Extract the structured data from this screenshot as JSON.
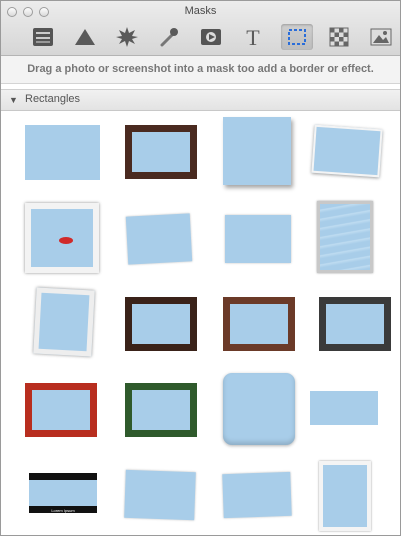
{
  "window": {
    "title": "Masks"
  },
  "toolbar": {
    "tools": [
      {
        "icon": "layers-icon"
      },
      {
        "icon": "triangle-icon"
      },
      {
        "icon": "starburst-icon"
      },
      {
        "icon": "brush-icon"
      },
      {
        "icon": "video-icon"
      },
      {
        "icon": "text-icon",
        "glyph": "T"
      },
      {
        "icon": "selection-rect-icon",
        "selected": true
      },
      {
        "icon": "checkerboard-icon"
      },
      {
        "icon": "image-icon"
      }
    ]
  },
  "instructions": "Drag a photo or screenshot into a mask too add a border or effect.",
  "section": {
    "label": "Rectangles",
    "expanded": true
  },
  "masks": {
    "row_count": 5,
    "columns": 4,
    "caption_text": "Lorem Ipsum"
  },
  "colors": {
    "mask_fill": "#a8cde9",
    "dark_wood": "#4a2a20",
    "brown_wood": "#6b3a28",
    "dark_gray_frame": "#3a3a3a",
    "red_frame": "#b82e1f",
    "green_frame": "#2f5a2c",
    "selection_blue": "#2a6dd9"
  }
}
